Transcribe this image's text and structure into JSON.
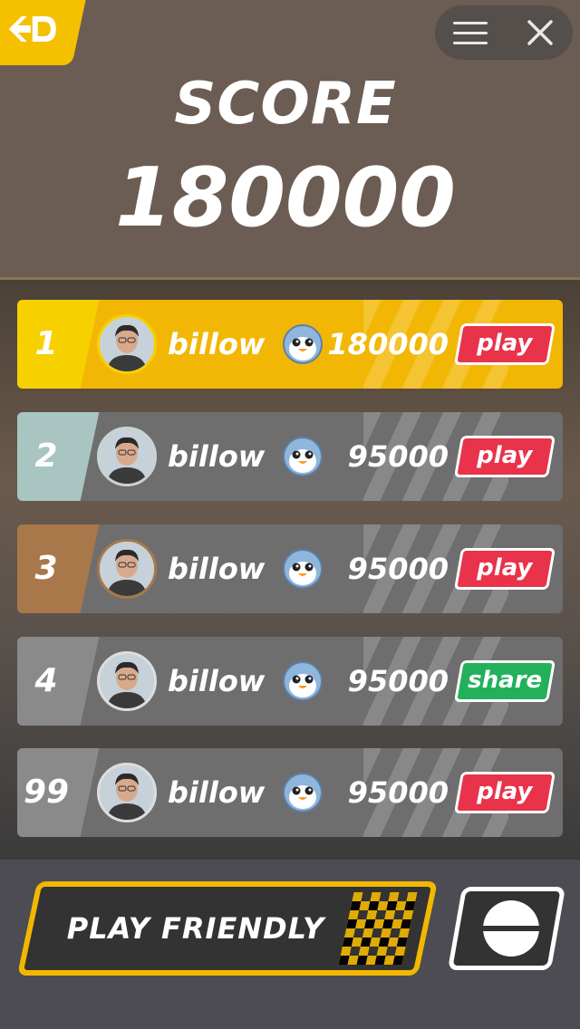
{
  "header": {
    "score_label": "SCORE",
    "score_value": "180000",
    "logo_icon": "hd-logo-icon",
    "menu_icon": "menu-icon",
    "close_icon": "close-icon"
  },
  "leaderboard": {
    "rows": [
      {
        "rank": "1",
        "name": "billow",
        "score": "180000",
        "action": "play",
        "rank_color": "#f7d000",
        "row_color": "#f2b705",
        "avatar_ring": "#f7d000"
      },
      {
        "rank": "2",
        "name": "billow",
        "score": "95000",
        "action": "play",
        "rank_color": "#a9c5c2",
        "row_color": "#6e6e6e",
        "avatar_ring": "#c9d3d2"
      },
      {
        "rank": "3",
        "name": "billow",
        "score": "95000",
        "action": "play",
        "rank_color": "#a8784a",
        "row_color": "#6e6e6e",
        "avatar_ring": "#a8784a"
      },
      {
        "rank": "4",
        "name": "billow",
        "score": "95000",
        "action": "share",
        "rank_color": "#8a8a8a",
        "row_color": "#6e6e6e",
        "avatar_ring": "#dddddd"
      },
      {
        "rank": "99",
        "name": "billow",
        "score": "95000",
        "action": "play",
        "rank_color": "#8a8a8a",
        "row_color": "#6e6e6e",
        "avatar_ring": "#dddddd"
      }
    ]
  },
  "footer": {
    "play_friendly_label": "PLAY  FRIENDLY",
    "ball_icon": "ball-icon"
  },
  "colors": {
    "accent": "#f2b800",
    "play_button": "#e8334a",
    "share_button": "#22b15a"
  }
}
